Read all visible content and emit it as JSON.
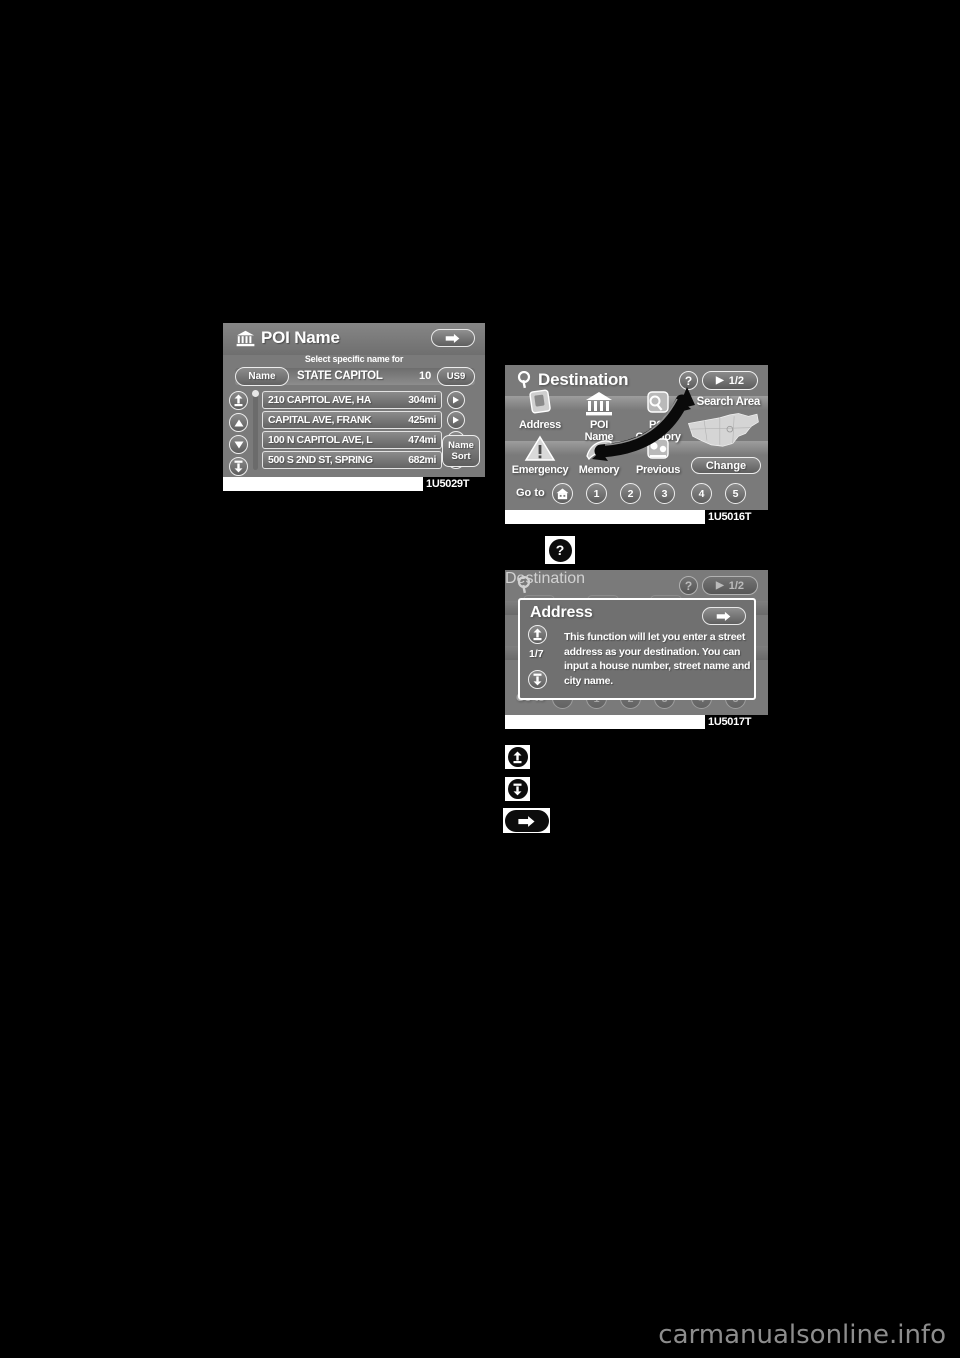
{
  "page": {
    "background_color": "#000000",
    "watermark": "carmanualsonline.info"
  },
  "screens": [
    {
      "id": "poi-name",
      "caption": "1U5029T",
      "header": {
        "title": "POI Name",
        "icon": "bank-icon",
        "back_button": "back-arrow-icon"
      },
      "subtitle": "Select specific name for",
      "search_bar": {
        "name_button": "Name",
        "query": "STATE CAPITOL",
        "result_count": "10",
        "region_button": "US9"
      },
      "list": [
        {
          "address": "210 CAPITOL AVE, HA",
          "distance": "304mi"
        },
        {
          "address": "CAPITAL AVE, FRANK",
          "distance": "425mi"
        },
        {
          "address": "100 N CAPITOL AVE, L",
          "distance": "474mi"
        },
        {
          "address": "500 S 2ND ST, SPRING",
          "distance": "682mi"
        }
      ],
      "sort_button": {
        "line1": "Name",
        "line2": "Sort"
      }
    },
    {
      "id": "destination",
      "caption": "1U5016T",
      "header": {
        "title": "Destination",
        "icon": "map-pin-search-icon",
        "help_button": "?",
        "page_indicator": "1/2",
        "page_arrow": "▶"
      },
      "menu_items": [
        {
          "label": "Address",
          "icon": "address-card-icon"
        },
        {
          "label": "POI\nName",
          "label_line1": "POI",
          "label_line2": "Name",
          "icon": "bank-icon"
        },
        {
          "label": "POI\nCategory",
          "label_line1": "POI",
          "label_line2": "Category",
          "icon": "poi-category-icon"
        },
        {
          "label": "Emergency",
          "icon": "warning-triangle-icon"
        },
        {
          "label": "Memory",
          "icon": "memory-star-icon"
        },
        {
          "label": "Previous",
          "icon": "previous-history-icon"
        }
      ],
      "search_area": {
        "label": "Search Area",
        "map_icon": "us-map-icon",
        "change_button": "Change"
      },
      "goto": {
        "label": "Go to",
        "home_button": "home-icon",
        "presets": [
          "1",
          "2",
          "3",
          "4",
          "5"
        ]
      },
      "annotation_arrow": "curved-arrow-overlay"
    },
    {
      "id": "address-help",
      "caption": "1U5017T",
      "header": {
        "title": "Destination",
        "icon": "map-pin-search-icon",
        "help_button": "?",
        "page_indicator": "1/2",
        "page_arrow": "▶"
      },
      "dialog": {
        "title": "Address",
        "back_button": "back-arrow-icon",
        "page_number": "1/7",
        "scroll_up": "page-up-icon",
        "scroll_down": "page-down-icon",
        "body": "This function will let you enter a street address as your destination. You can input a house number, street name and city name."
      },
      "background_goto_label": "Go to"
    }
  ],
  "callouts": {
    "help_icon_label": "?",
    "legend_icons": [
      {
        "name": "page-up-icon",
        "glyph": "up"
      },
      {
        "name": "page-down-icon",
        "glyph": "down"
      },
      {
        "name": "back-icon",
        "glyph": "back"
      }
    ]
  }
}
